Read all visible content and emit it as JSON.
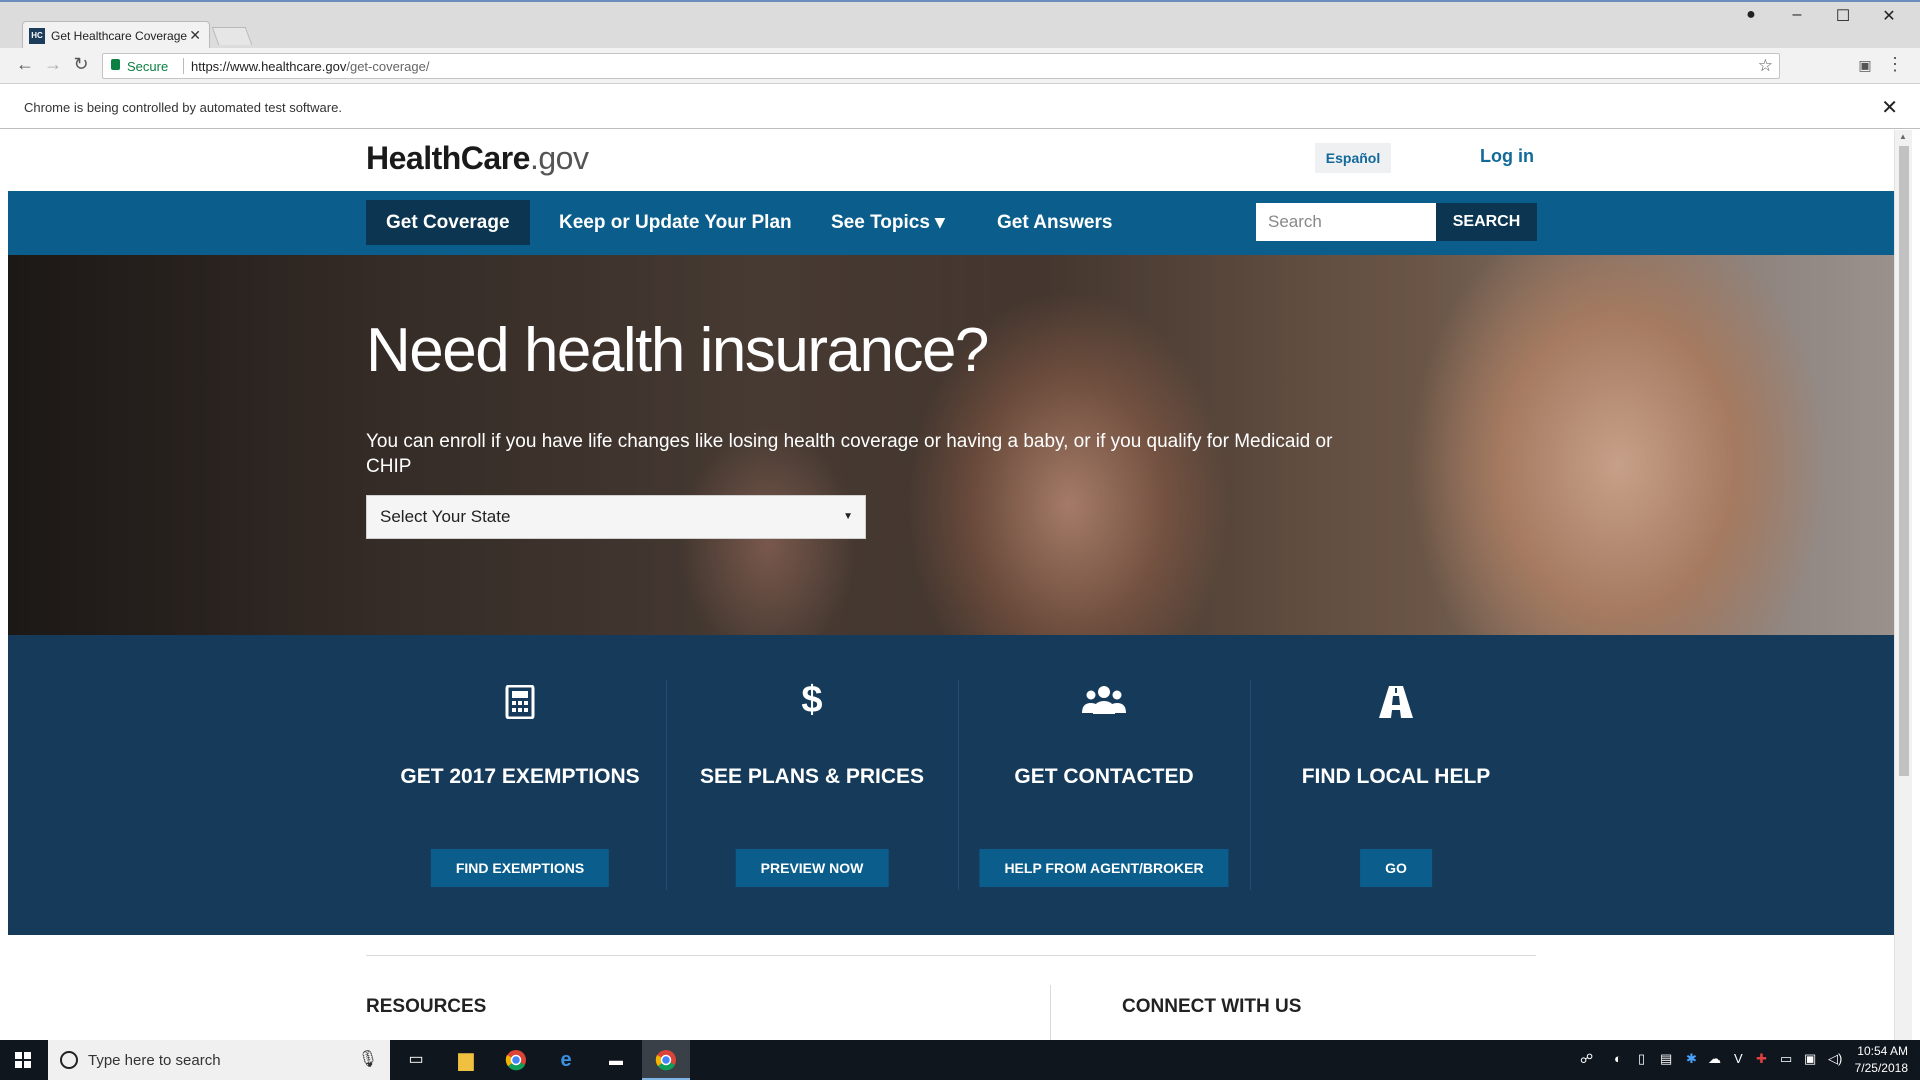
{
  "browser": {
    "tab_title": "Get Healthcare Coverage",
    "tab_favicon": "HC",
    "secure_label": "Secure",
    "url_host": "https://www.healthcare.gov",
    "url_path": "/get-coverage/",
    "automation_notice": "Chrome is being controlled by automated test software."
  },
  "header": {
    "logo_main": "HealthCare",
    "logo_suffix": ".gov",
    "espanol": "Español",
    "login": "Log in"
  },
  "nav": {
    "items": [
      {
        "label": "Get Coverage",
        "active": true
      },
      {
        "label": "Keep or Update Your Plan"
      },
      {
        "label": "See Topics ▾"
      },
      {
        "label": "Get Answers"
      }
    ],
    "search_placeholder": "Search",
    "search_button": "SEARCH"
  },
  "hero": {
    "title": "Need health insurance?",
    "text": "You can enroll if you have life changes like losing health coverage or having a baby, or if you qualify for Medicaid or CHIP",
    "state_select": "Select Your State"
  },
  "features": [
    {
      "icon": "calculator-icon",
      "title": "GET 2017 EXEMPTIONS",
      "button": "FIND EXEMPTIONS"
    },
    {
      "icon": "dollar-icon",
      "title": "SEE PLANS & PRICES",
      "button": "PREVIEW NOW"
    },
    {
      "icon": "people-icon",
      "title": "GET CONTACTED",
      "button": "HELP FROM AGENT/BROKER"
    },
    {
      "icon": "road-icon",
      "title": "FIND LOCAL HELP",
      "button": "GO"
    }
  ],
  "footer": {
    "resources": "RESOURCES",
    "connect": "CONNECT WITH US"
  },
  "taskbar": {
    "search_placeholder": "Type here to search",
    "time": "10:54 AM",
    "date": "7/25/2018"
  },
  "colors": {
    "nav_bg": "#0b5e8c",
    "nav_active": "#0b3550",
    "features_bg": "#153a5a",
    "link": "#12699a"
  }
}
